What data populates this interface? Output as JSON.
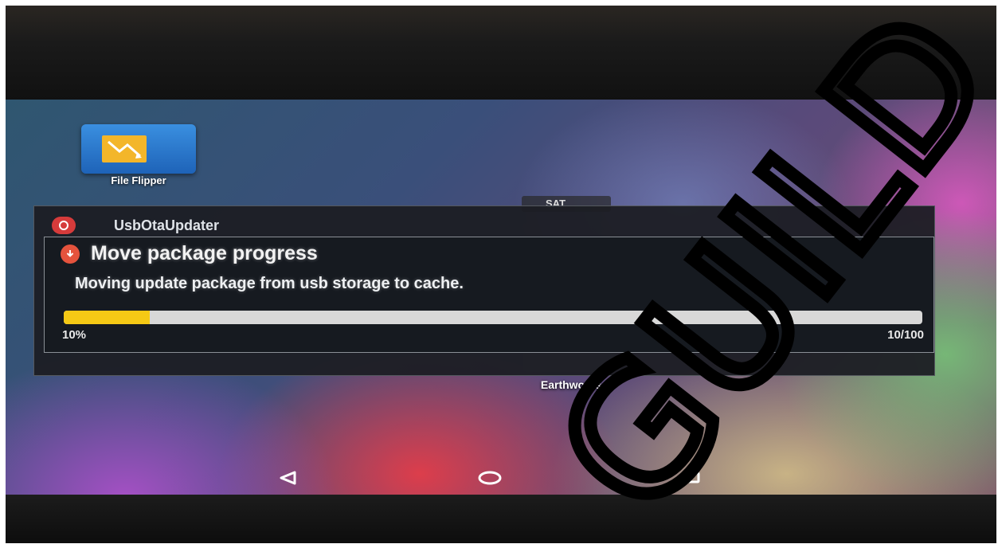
{
  "desktop": {
    "app_label": "File Flipper",
    "under_dialog_label": "Earthworks",
    "clock_text": "SAT"
  },
  "outer_dialog": {
    "title": "UsbOtaUpdater"
  },
  "dialog": {
    "title": "Move package progress",
    "message": "Moving update package from usb storage to cache.",
    "percent_text": "10%",
    "count_text": "10/100",
    "progress_value": 10,
    "progress_max": 100
  },
  "navbar": {
    "back_icon": "back-triangle-icon",
    "home_icon": "home-circle-icon",
    "recents_icon": "recents-square-icon"
  },
  "watermark": {
    "text": "GUILD"
  },
  "colors": {
    "progress_fill": "#f5c915",
    "progress_track": "#d8d8d8",
    "app_icon_blue": "#2f7fd6",
    "alert_red": "#e5533d"
  }
}
